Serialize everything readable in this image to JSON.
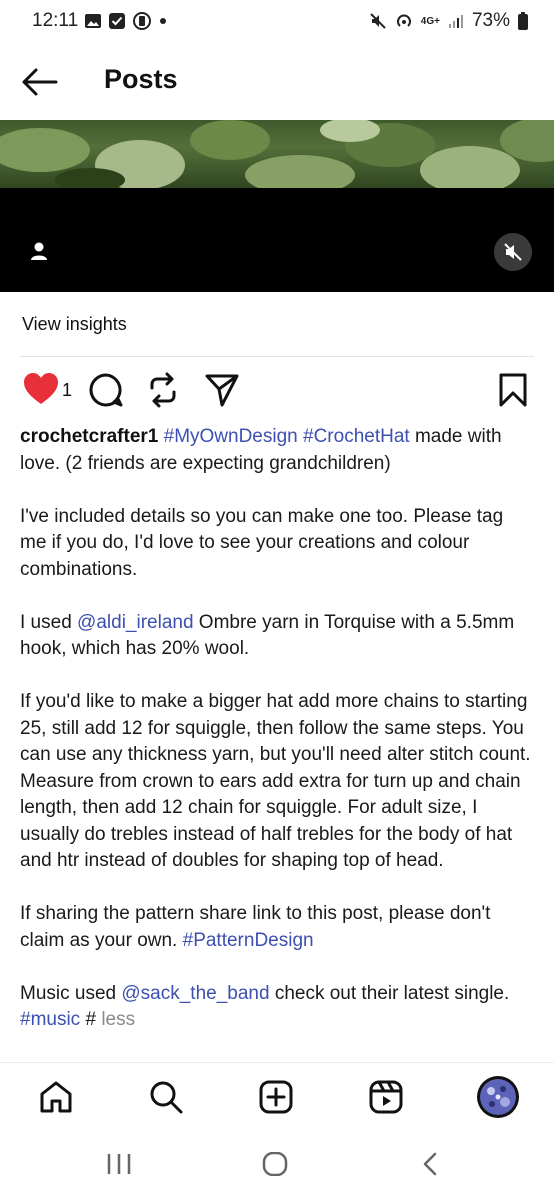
{
  "status_bar": {
    "time": "12:11",
    "network": "4G+",
    "battery": "73%"
  },
  "header": {
    "title": "Posts"
  },
  "post": {
    "insights_label": "View insights",
    "like_count": "1",
    "caption": {
      "username": "crochetcrafter1",
      "tag_my_own_design": "#MyOwnDesign",
      "tag_crochet_hat": "#CrochetHat",
      "line1_rest": " made with love. (2 friends are expecting grandchildren)",
      "para2": "I've included details so you can make one too. Please tag me if you do, I'd love to see your creations and colour combinations.",
      "para3_before": "I used ",
      "mention_aldi": "@aldi_ireland",
      "para3_after": " Ombre yarn in Torquise with a 5.5mm hook, which has 20% wool.",
      "para4": "If you'd like to make a bigger hat add more chains to starting 25, still add 12 for squiggle, then follow the same steps. You can use any thickness yarn, but you'll need alter stitch count. Measure from crown to ears add extra for turn up and chain length, then add 12 chain for squiggle. For adult size, I usually do trebles instead of half trebles for the body of hat and htr instead of doubles for shaping top of head.",
      "para5_before": "If sharing the pattern share link to this post, please don't claim as your own. ",
      "tag_pattern_design": "#PatternDesign",
      "para6_before": "Music used ",
      "mention_sack": "@sack_the_band",
      "para6_after": " check out their latest single. ",
      "tag_music": "#music",
      "trailing_hash": " # ",
      "less_label": "less"
    }
  },
  "colors": {
    "like_red": "#e8303a",
    "link_blue": "#3d4fb0",
    "muted_gray": "#8a8a8a"
  },
  "icons": {
    "back": "arrow-left-icon",
    "like": "heart-filled-icon",
    "comment": "comment-bubble-icon",
    "repost": "repost-icon",
    "share": "paper-plane-icon",
    "save": "bookmark-icon",
    "home": "home-icon",
    "search": "search-icon",
    "create": "plus-square-icon",
    "reels": "reels-icon",
    "profile": "avatar",
    "mute": "speaker-muted-icon",
    "tag_people": "person-icon"
  }
}
